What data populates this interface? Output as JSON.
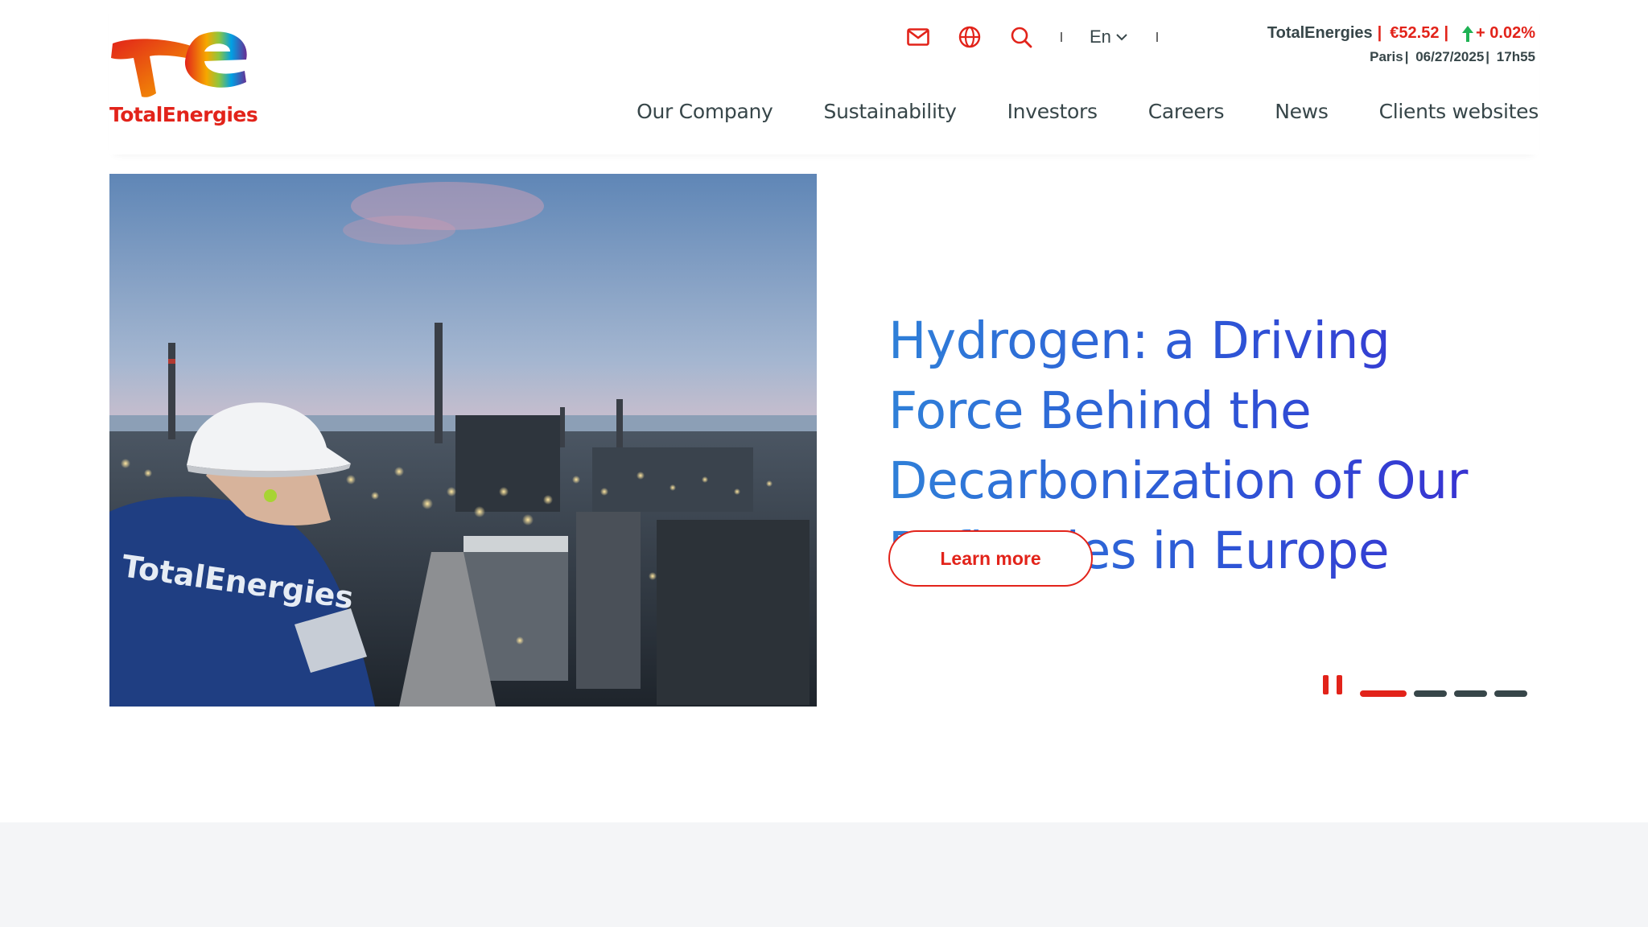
{
  "brand": {
    "name": "TotalEnergies",
    "colors": {
      "red": "#e2231a",
      "text": "#374649",
      "hero_blue": "#2f80d8",
      "hero_indigo": "#3a2ad0",
      "up_green": "#1fb254"
    }
  },
  "utility": {
    "icons": [
      "mail-icon",
      "globe-icon",
      "search-icon"
    ],
    "language": "En"
  },
  "stock": {
    "company": "TotalEnergies",
    "price": "€52.52",
    "change": "+ 0.02%",
    "direction": "up",
    "market": "Paris",
    "date": "06/27/2025",
    "time": "17h55"
  },
  "nav": {
    "items": [
      "Our Company",
      "Sustainability",
      "Investors",
      "Careers",
      "News",
      "Clients websites"
    ]
  },
  "hero": {
    "image_text": "TotalEnergies",
    "title": "Hydrogen: a Driving Force Behind the Decarbonization of Our Refineries in Europe",
    "cta": "Learn more",
    "slides_total": 4,
    "active_slide": 1
  }
}
